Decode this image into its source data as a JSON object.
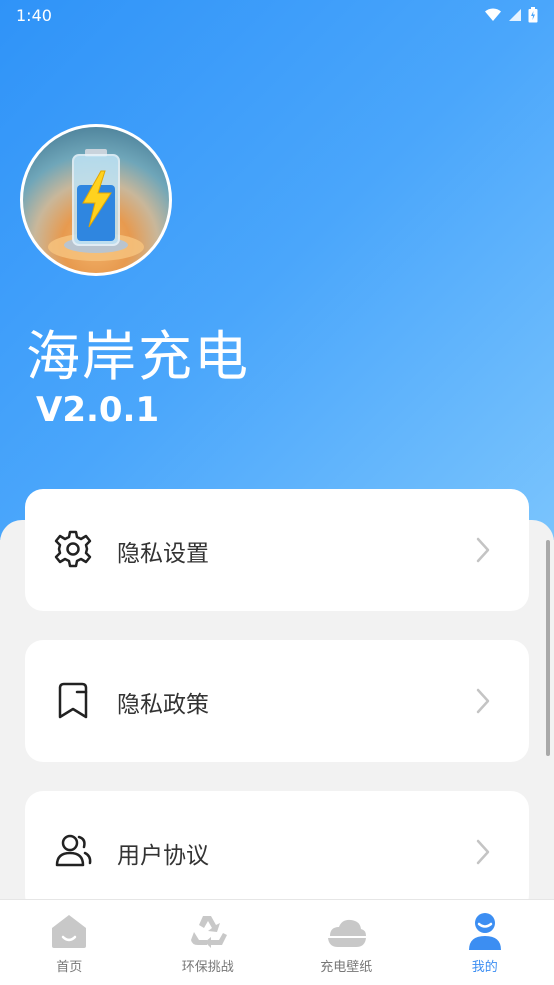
{
  "status_bar": {
    "time": "1:40",
    "icons": [
      "wifi-icon",
      "signal-icon",
      "battery-icon"
    ]
  },
  "profile": {
    "avatar_icon": "battery-charging-icon",
    "app_name": "海岸充电",
    "version": "V2.0.1"
  },
  "menu": {
    "items": [
      {
        "label": "隐私设置",
        "icon": "gear-icon"
      },
      {
        "label": "隐私政策",
        "icon": "bookmark-icon"
      },
      {
        "label": "用户协议",
        "icon": "users-icon"
      }
    ]
  },
  "tabbar": {
    "tabs": [
      {
        "label": "首页",
        "icon": "home-icon",
        "active": false
      },
      {
        "label": "环保挑战",
        "icon": "recycle-icon",
        "active": false
      },
      {
        "label": "充电壁纸",
        "icon": "cloud-icon",
        "active": false
      },
      {
        "label": "我的",
        "icon": "user-icon",
        "active": true
      }
    ]
  },
  "colors": {
    "hero_gradient_start": "#2f93f8",
    "hero_gradient_end": "#7ac4fd",
    "active_tab": "#3c8ef2",
    "inactive_tab": "#c8c8c8",
    "background": "#f2f2f2"
  }
}
